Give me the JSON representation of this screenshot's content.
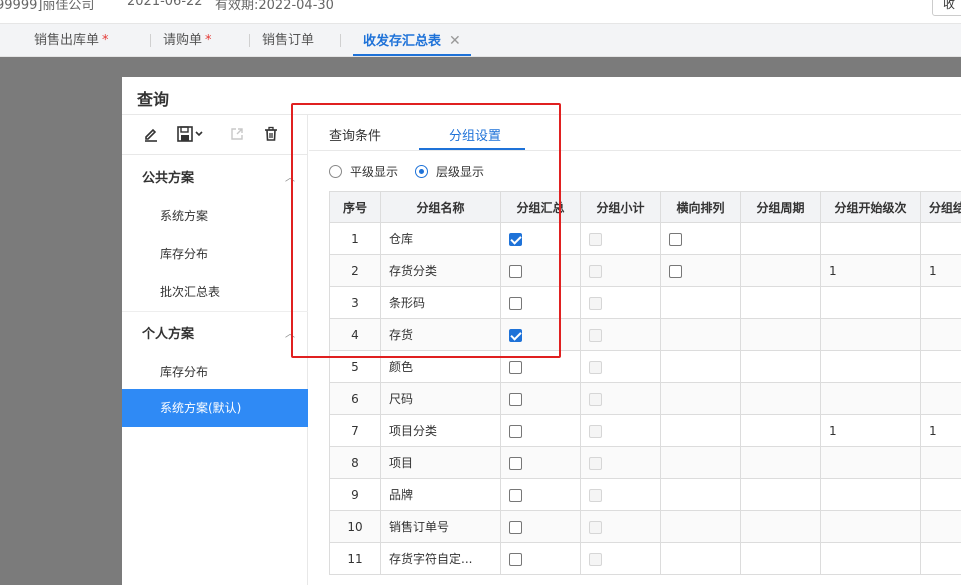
{
  "topbar": {
    "company": "99999]丽佳公司",
    "date": "2021-06-22",
    "valid": "有效期:2022-04-30",
    "corner_button": "收"
  },
  "tabs": [
    {
      "label": "销售出库单",
      "star": "*"
    },
    {
      "label": "请购单",
      "star": "*"
    },
    {
      "label": "销售订单",
      "star": ""
    },
    {
      "label": "收发存汇总表",
      "star": ""
    }
  ],
  "dialog": {
    "title": "查询",
    "toolbar_icons": [
      "edit-icon",
      "save-icon",
      "export-icon",
      "delete-icon"
    ],
    "sidebar": {
      "public_title": "公共方案",
      "public_items": [
        "系统方案",
        "库存分布",
        "批次汇总表"
      ],
      "personal_title": "个人方案",
      "personal_items": [
        "库存分布",
        "系统方案(默认)"
      ]
    },
    "main_tabs": [
      "查询条件",
      "分组设置"
    ],
    "active_main_tab": 1,
    "radios": [
      {
        "label": "平级显示",
        "checked": false
      },
      {
        "label": "层级显示",
        "checked": true
      }
    ],
    "columns": [
      "序号",
      "分组名称",
      "分组汇总",
      "分组小计",
      "横向排列",
      "分组周期",
      "分组开始级次",
      "分组结"
    ],
    "rows": [
      {
        "no": "1",
        "name": "仓库",
        "summary": true,
        "horizontal": "unchecked",
        "start_level": "",
        "end_level": ""
      },
      {
        "no": "2",
        "name": "存货分类",
        "summary": false,
        "horizontal": "unchecked",
        "start_level": "1",
        "end_level": "1"
      },
      {
        "no": "3",
        "name": "条形码",
        "summary": false,
        "horizontal": "none",
        "start_level": "",
        "end_level": ""
      },
      {
        "no": "4",
        "name": "存货",
        "summary": true,
        "horizontal": "none",
        "start_level": "",
        "end_level": ""
      },
      {
        "no": "5",
        "name": "颜色",
        "summary": false,
        "horizontal": "none",
        "start_level": "",
        "end_level": ""
      },
      {
        "no": "6",
        "name": "尺码",
        "summary": false,
        "horizontal": "none",
        "start_level": "",
        "end_level": ""
      },
      {
        "no": "7",
        "name": "项目分类",
        "summary": false,
        "horizontal": "none",
        "start_level": "1",
        "end_level": "1"
      },
      {
        "no": "8",
        "name": "项目",
        "summary": false,
        "horizontal": "none",
        "start_level": "",
        "end_level": ""
      },
      {
        "no": "9",
        "name": "品牌",
        "summary": false,
        "horizontal": "none",
        "start_level": "",
        "end_level": ""
      },
      {
        "no": "10",
        "name": "销售订单号",
        "summary": false,
        "horizontal": "none",
        "start_level": "",
        "end_level": ""
      },
      {
        "no": "11",
        "name": "存货字符自定...",
        "summary": false,
        "horizontal": "none",
        "start_level": "",
        "end_level": ""
      }
    ]
  },
  "colors": {
    "accent": "#1e72d8",
    "highlight_box": "#e02020",
    "active_item_bg": "#2f8af5"
  }
}
